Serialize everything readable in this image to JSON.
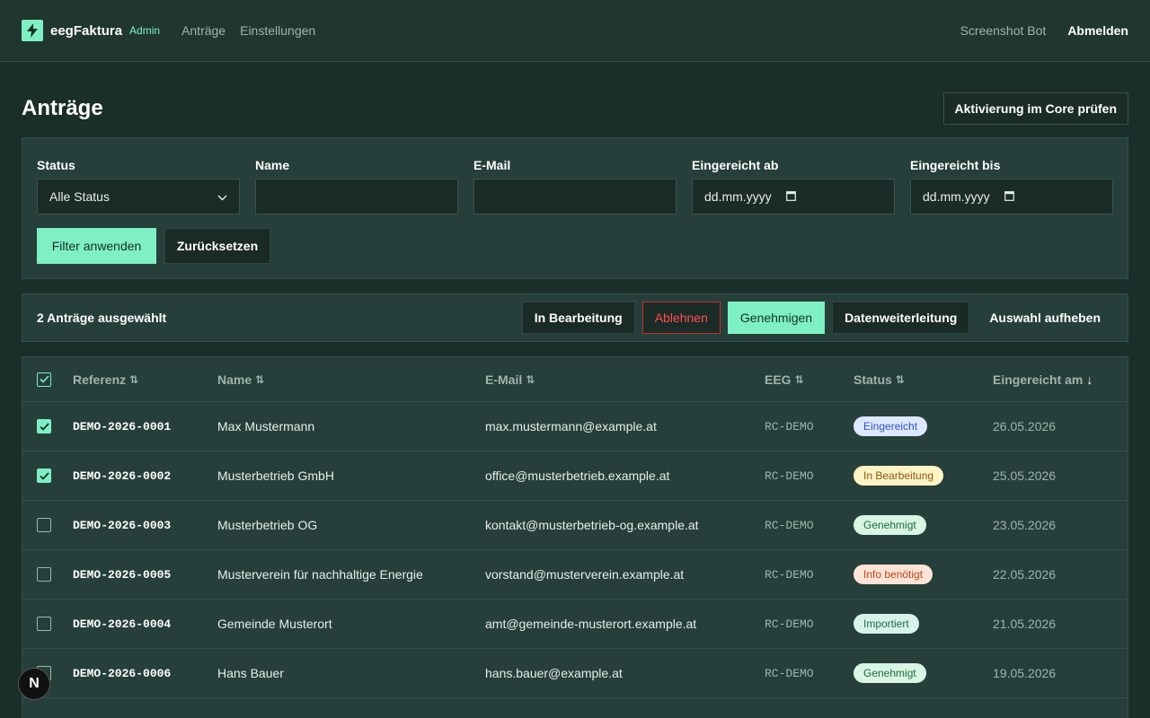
{
  "header": {
    "brand": "eegFaktura",
    "brand_tag": "Admin",
    "nav": [
      "Anträge",
      "Einstellungen"
    ],
    "user": "Screenshot Bot",
    "logout": "Abmelden"
  },
  "page": {
    "title": "Anträge",
    "core_button": "Aktivierung im Core prüfen"
  },
  "filters": {
    "status_label": "Status",
    "status_value": "Alle Status",
    "name_label": "Name",
    "name_value": "",
    "email_label": "E-Mail",
    "email_value": "",
    "from_label": "Eingereicht ab",
    "from_placeholder": "dd.mm.yyyy",
    "to_label": "Eingereicht bis",
    "to_placeholder": "dd.mm.yyyy",
    "apply": "Filter anwenden",
    "reset": "Zurücksetzen"
  },
  "selection": {
    "count_text": "2 Anträge ausgewählt",
    "actions": {
      "in_progress": "In Bearbeitung",
      "reject": "Ablehnen",
      "approve": "Genehmigen",
      "forward": "Datenweiterleitung",
      "clear": "Auswahl aufheben"
    }
  },
  "table": {
    "columns": {
      "ref": "Referenz",
      "name": "Name",
      "email": "E-Mail",
      "eeg": "EEG",
      "status": "Status",
      "submitted": "Eingereicht am"
    },
    "header_checked": true,
    "rows": [
      {
        "checked": true,
        "ref": "DEMO-2026-0001",
        "name": "Max Mustermann",
        "email": "max.mustermann@example.at",
        "eeg": "RC-DEMO",
        "status": "Eingereicht",
        "status_bg": "#dde8ff",
        "status_fg": "#2f55c9",
        "date": "26.05.2026"
      },
      {
        "checked": true,
        "ref": "DEMO-2026-0002",
        "name": "Musterbetrieb GmbH",
        "email": "office@musterbetrieb.example.at",
        "eeg": "RC-DEMO",
        "status": "In Bearbeitung",
        "status_bg": "#fdf3c4",
        "status_fg": "#8a5a12",
        "date": "25.05.2026"
      },
      {
        "checked": false,
        "ref": "DEMO-2026-0003",
        "name": "Musterbetrieb OG",
        "email": "kontakt@musterbetrieb-og.example.at",
        "eeg": "RC-DEMO",
        "status": "Genehmigt",
        "status_bg": "#d9f5e4",
        "status_fg": "#1f6b43",
        "date": "23.05.2026"
      },
      {
        "checked": false,
        "ref": "DEMO-2026-0005",
        "name": "Musterverein für nachhaltige Energie",
        "email": "vorstand@musterverein.example.at",
        "eeg": "RC-DEMO",
        "status": "Info benötigt",
        "status_bg": "#fde4d6",
        "status_fg": "#b5471c",
        "date": "22.05.2026"
      },
      {
        "checked": false,
        "ref": "DEMO-2026-0004",
        "name": "Gemeinde Musterort",
        "email": "amt@gemeinde-musterort.example.at",
        "eeg": "RC-DEMO",
        "status": "Importiert",
        "status_bg": "#d7f2ea",
        "status_fg": "#1d6b55",
        "date": "21.05.2026"
      },
      {
        "checked": false,
        "ref": "DEMO-2026-0006",
        "name": "Hans Bauer",
        "email": "hans.bauer@example.at",
        "eeg": "RC-DEMO",
        "status": "Genehmigt",
        "status_bg": "#d9f5e4",
        "status_fg": "#1f6b43",
        "date": "19.05.2026"
      }
    ]
  },
  "dev_badge": "N",
  "icons": {
    "logo": "lightning-bolt-icon",
    "select": "chevron-down-icon",
    "date": "calendar-icon",
    "sort": "sort-arrows-icon",
    "sort_active": "arrow-down-icon",
    "checkbox": "checkmark-icon"
  },
  "colors": {
    "accent": "#7ef0c4",
    "danger": "#ff4d4d",
    "background": "#1a2e2a",
    "panel": "#263f3a"
  }
}
